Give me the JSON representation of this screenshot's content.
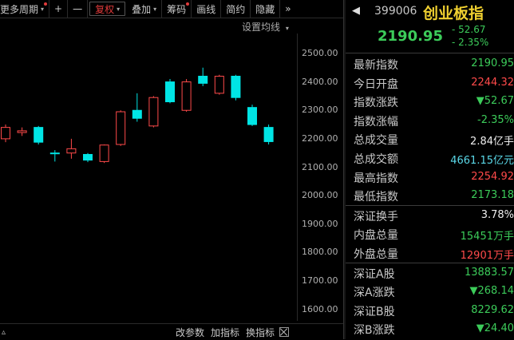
{
  "toolbar": {
    "items": [
      {
        "label": "更多周期",
        "caret": "▾",
        "dot": true
      },
      {
        "label": "+"
      },
      {
        "label": "一"
      },
      {
        "label": "复权",
        "caret": "▾"
      },
      {
        "label": "叠加",
        "caret": "▾"
      },
      {
        "label": "筹码",
        "dot": true
      },
      {
        "label": "画线"
      },
      {
        "label": "简约"
      },
      {
        "label": "隐藏"
      },
      {
        "label": "»"
      }
    ]
  },
  "chart": {
    "setup_ma": "设置均线",
    "caret": "▾",
    "y_ticks": [
      "2500.00",
      "2400.00",
      "2300.00",
      "2200.00",
      "2100.00",
      "2000.00",
      "1900.00",
      "1800.00",
      "1700.00",
      "1600.00"
    ],
    "colors": {
      "up": "#ff4a4a",
      "down": "#00e5e5"
    }
  },
  "chart_data": {
    "type": "candlestick",
    "ylim": [
      1560,
      2570
    ],
    "y_ticks": [
      2500,
      2400,
      2300,
      2200,
      2100,
      2000,
      1900,
      1800,
      1700,
      1600
    ],
    "candles": [
      {
        "open": 2200,
        "high": 2250,
        "low": 2188,
        "close": 2240
      },
      {
        "open": 2222,
        "high": 2240,
        "low": 2210,
        "close": 2228
      },
      {
        "open": 2240,
        "high": 2245,
        "low": 2180,
        "close": 2188
      },
      {
        "open": 2150,
        "high": 2160,
        "low": 2120,
        "close": 2148
      },
      {
        "open": 2150,
        "high": 2200,
        "low": 2130,
        "close": 2165
      },
      {
        "open": 2145,
        "high": 2150,
        "low": 2118,
        "close": 2125
      },
      {
        "open": 2120,
        "high": 2180,
        "low": 2115,
        "close": 2178
      },
      {
        "open": 2180,
        "high": 2300,
        "low": 2175,
        "close": 2295
      },
      {
        "open": 2300,
        "high": 2360,
        "low": 2260,
        "close": 2272
      },
      {
        "open": 2245,
        "high": 2350,
        "low": 2240,
        "close": 2345
      },
      {
        "open": 2400,
        "high": 2410,
        "low": 2325,
        "close": 2330
      },
      {
        "open": 2300,
        "high": 2410,
        "low": 2295,
        "close": 2400
      },
      {
        "open": 2420,
        "high": 2450,
        "low": 2385,
        "close": 2395
      },
      {
        "open": 2360,
        "high": 2425,
        "low": 2355,
        "close": 2420
      },
      {
        "open": 2420,
        "high": 2425,
        "low": 2335,
        "close": 2345
      },
      {
        "open": 2310,
        "high": 2320,
        "low": 2245,
        "close": 2250
      },
      {
        "open": 2240,
        "high": 2250,
        "low": 2180,
        "close": 2190
      }
    ]
  },
  "bottombar": {
    "items": [
      "改参数",
      "加指标",
      "换指标"
    ]
  },
  "panel": {
    "nav_left": "◀",
    "code": "399006",
    "name": "创业板指",
    "price": "2190.95",
    "change": "- 52.67",
    "percent": "- 2.35%",
    "rows": [
      {
        "label": "最新指数",
        "value": "2190.95",
        "color": "green"
      },
      {
        "label": "今日开盘",
        "value": "2244.32",
        "color": "red2"
      },
      {
        "label": "指数涨跌",
        "value": "▼52.67",
        "color": "green"
      },
      {
        "label": "指数涨幅",
        "value": "-2.35%",
        "color": "green"
      },
      {
        "label": "总成交量",
        "value": "2.84亿手",
        "color": "white"
      },
      {
        "label": "总成交额",
        "value": "4661.15亿元",
        "color": "aqua"
      },
      {
        "label": "最高指数",
        "value": "2254.92",
        "color": "red2"
      },
      {
        "label": "最低指数",
        "value": "2173.18",
        "color": "green"
      },
      {
        "sep": true
      },
      {
        "label": "深证换手",
        "value": "3.78%",
        "color": "white"
      },
      {
        "label": "内盘总量",
        "value": "15451万手",
        "color": "green"
      },
      {
        "label": "外盘总量",
        "value": "12901万手",
        "color": "red2"
      },
      {
        "sep": true
      },
      {
        "label": "深证A股",
        "value": "13883.57",
        "color": "green"
      },
      {
        "label": "深A涨跌",
        "value": "▼268.14",
        "color": "green"
      },
      {
        "label": "深证B股",
        "value": "8229.62",
        "color": "green"
      },
      {
        "label": "深B涨跌",
        "value": "▼24.40",
        "color": "green"
      }
    ]
  }
}
